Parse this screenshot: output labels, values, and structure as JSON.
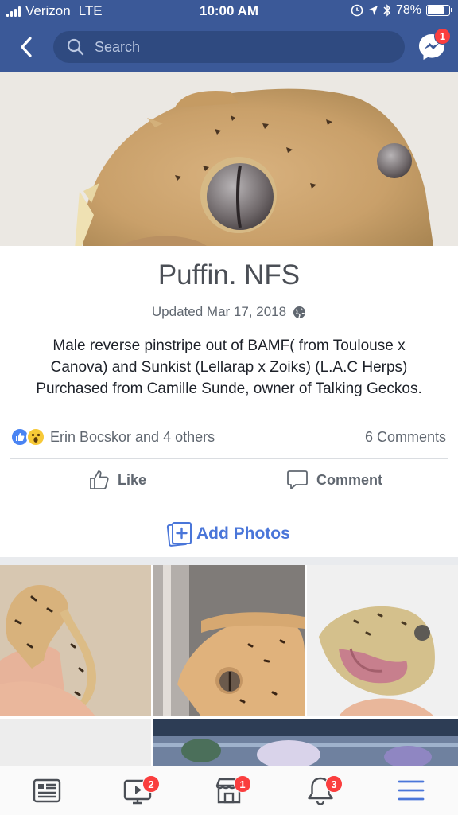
{
  "status_bar": {
    "carrier": "Verizon",
    "network": "LTE",
    "time": "10:00 AM",
    "battery": "78%",
    "battery_level": 0.78
  },
  "header": {
    "search_placeholder": "Search",
    "messenger_badge": "1",
    "brand_color": "#3b5998"
  },
  "album": {
    "title": "Puffin. NFS",
    "updated": "Updated Mar 17, 2018",
    "privacy_icon": "globe-icon",
    "description": "Male reverse pinstripe out of BAMF( from Toulouse x Canova) and Sunkist (Lellarap x Zoiks) (L.A.C Herps) Purchased from Camille Sunde, owner of Talking Geckos."
  },
  "engagement": {
    "reaction_names": "Erin Bocskor and 4 others",
    "comments": "6 Comments",
    "like_label": "Like",
    "comment_label": "Comment",
    "add_photos_label": "Add Photos"
  },
  "bottom_nav": {
    "tabs": [
      {
        "name": "news-feed",
        "icon": "news-feed-icon",
        "badge": ""
      },
      {
        "name": "watch",
        "icon": "video-icon",
        "badge": "2"
      },
      {
        "name": "marketplace",
        "icon": "marketplace-icon",
        "badge": "1"
      },
      {
        "name": "notifications",
        "icon": "bell-icon",
        "badge": "3"
      },
      {
        "name": "menu",
        "icon": "hamburger-menu-icon",
        "badge": ""
      }
    ],
    "active_color": "#4a76d9"
  }
}
